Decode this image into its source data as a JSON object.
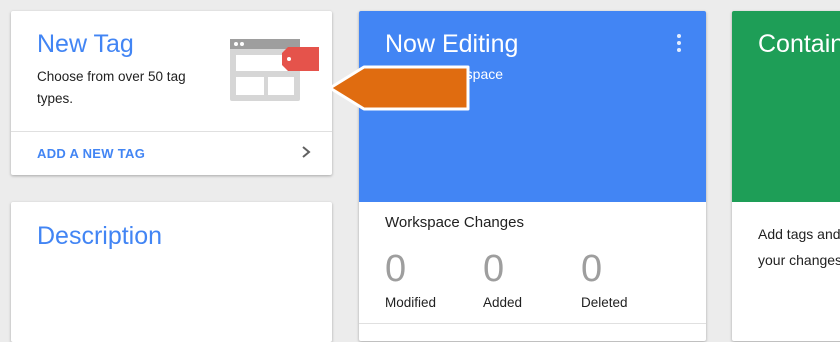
{
  "new_tag": {
    "title": "New Tag",
    "description": "Choose from over 50 tag types.",
    "action_label": "ADD A NEW TAG",
    "icons": {
      "illustration": "tag-browser-illustration-icon",
      "chevron": "chevron-right-icon"
    }
  },
  "description_card": {
    "title": "Description"
  },
  "now_editing": {
    "title": "Now Editing",
    "subtitle": "Default Workspace",
    "menu_icon": "more-vert-icon",
    "changes_title": "Workspace Changes",
    "stats": [
      {
        "value": "0",
        "label": "Modified"
      },
      {
        "value": "0",
        "label": "Added"
      },
      {
        "value": "0",
        "label": "Deleted"
      }
    ]
  },
  "container_card": {
    "title": "Container Summary",
    "body": "Add tags and publish to make your changes live."
  },
  "annotation": {
    "arrow_icon": "annotation-arrow-icon"
  },
  "colors": {
    "accent_blue": "#4285f4",
    "editing_header": "#4285f4",
    "container_header": "#1e9e57",
    "annotation_orange": "#e06c10",
    "tag_red": "#e5534b",
    "page_background": "#ececec"
  }
}
